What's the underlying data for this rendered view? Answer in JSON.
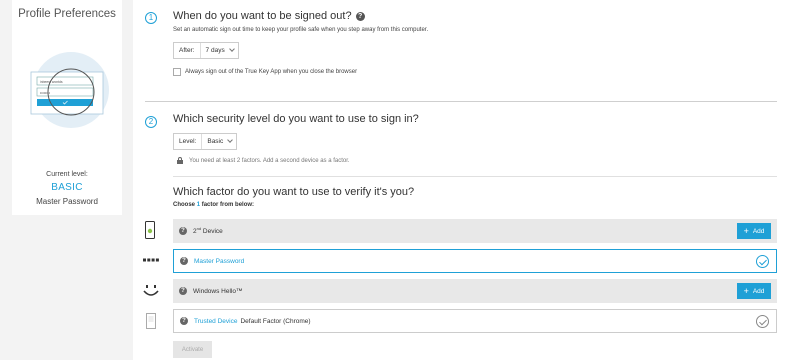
{
  "sidebar": {
    "title": "Profile Preferences",
    "illustration": {
      "field1_text": "inbeest wontds",
      "field2_text": "••••••••",
      "check_icon": "check-icon"
    },
    "current_level_label": "Current level:",
    "current_level_value": "BASIC",
    "current_factor": "Master Password"
  },
  "step1": {
    "number": "1",
    "question": "When do you want to be signed out?",
    "help_icon": "?",
    "subtext": "Set an automatic sign out time to keep your profile safe when you step away from this computer.",
    "after_label": "After:",
    "after_value": "7 days",
    "checkbox_label": "Always sign out of the True Key App when you close the browser",
    "checkbox_checked": false
  },
  "step2": {
    "number": "2",
    "question": "Which security level do you want to use to sign in?",
    "level_label": "Level:",
    "level_value": "Basic",
    "lock_note": "You need at least 2 factors. Add a second device as a factor.",
    "factor_question": "Which factor do you want to use to verify it's you?",
    "choose_prefix": "Choose",
    "choose_count": "1",
    "choose_suffix": "factor from below:",
    "factors": [
      {
        "icon": "phone-icon",
        "name": "2",
        "name_sup": "nd",
        "name_rest": " Device",
        "action": "Add",
        "state": "add"
      },
      {
        "icon": "password-dots-icon",
        "name": "Master Password",
        "state": "selected"
      },
      {
        "icon": "smiley-face-icon",
        "name": "Windows Hello™",
        "action": "Add",
        "state": "add"
      },
      {
        "icon": "device-frame-icon",
        "name": "Trusted Device",
        "extra": "Default Factor (Chrome)",
        "state": "enabled"
      }
    ],
    "activate_label": "Activate"
  },
  "colors": {
    "accent": "#1fa0d6",
    "background": "#f3f3f3",
    "row_gray": "#e8e8e8"
  }
}
